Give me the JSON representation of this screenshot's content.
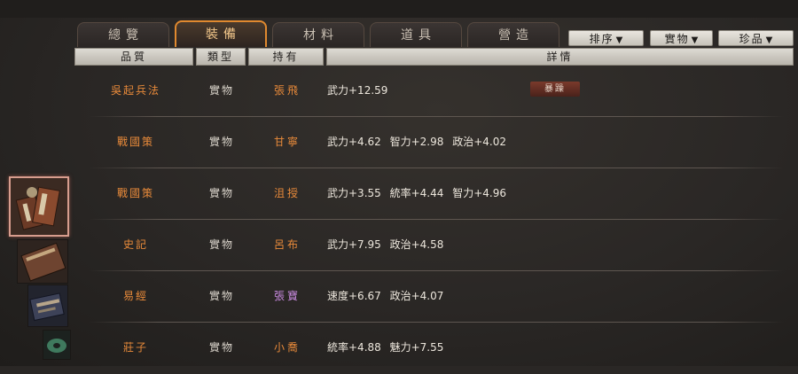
{
  "tabs": [
    {
      "label": "總覽",
      "active": false
    },
    {
      "label": "裝備",
      "active": true
    },
    {
      "label": "材料",
      "active": false
    },
    {
      "label": "道具",
      "active": false
    },
    {
      "label": "營造",
      "active": false
    }
  ],
  "dropdowns": [
    {
      "label": "排序",
      "arrow": "▼"
    },
    {
      "label": "實物",
      "arrow": "▼"
    },
    {
      "label": "珍品",
      "arrow": "▼"
    }
  ],
  "columns": {
    "quality": "品質",
    "type": "類型",
    "holder": "持有",
    "detail": "詳情"
  },
  "rows": [
    {
      "name": "吳起兵法",
      "type": "實物",
      "holder": "張飛",
      "holder_color": "#e88a3a",
      "stats": [
        "武力+12.59"
      ],
      "badge": "暴躁"
    },
    {
      "name": "戰國策",
      "type": "實物",
      "holder": "甘寧",
      "holder_color": "#e88a3a",
      "stats": [
        "武力+4.62",
        "智力+2.98",
        "政治+4.02"
      ]
    },
    {
      "name": "戰國策",
      "type": "實物",
      "holder": "沮授",
      "holder_color": "#e88a3a",
      "stats": [
        "武力+3.55",
        "統率+4.44",
        "智力+4.96"
      ]
    },
    {
      "name": "史記",
      "type": "實物",
      "holder": "呂布",
      "holder_color": "#e88a3a",
      "stats": [
        "武力+7.95",
        "政治+4.58"
      ]
    },
    {
      "name": "易經",
      "type": "實物",
      "holder": "張寶",
      "holder_color": "#c98ae0",
      "stats": [
        "速度+6.67",
        "政治+4.07"
      ]
    },
    {
      "name": "莊子",
      "type": "實物",
      "holder": "小喬",
      "holder_color": "#e88a3a",
      "stats": [
        "統率+4.88",
        "魅力+7.55"
      ]
    }
  ],
  "thumbnails": [
    {
      "icon": "book-bundle-icon",
      "selected": true
    },
    {
      "icon": "book-icon",
      "selected": false
    },
    {
      "icon": "scroll-book-icon",
      "selected": false
    },
    {
      "icon": "jade-disc-icon",
      "selected": false
    }
  ]
}
